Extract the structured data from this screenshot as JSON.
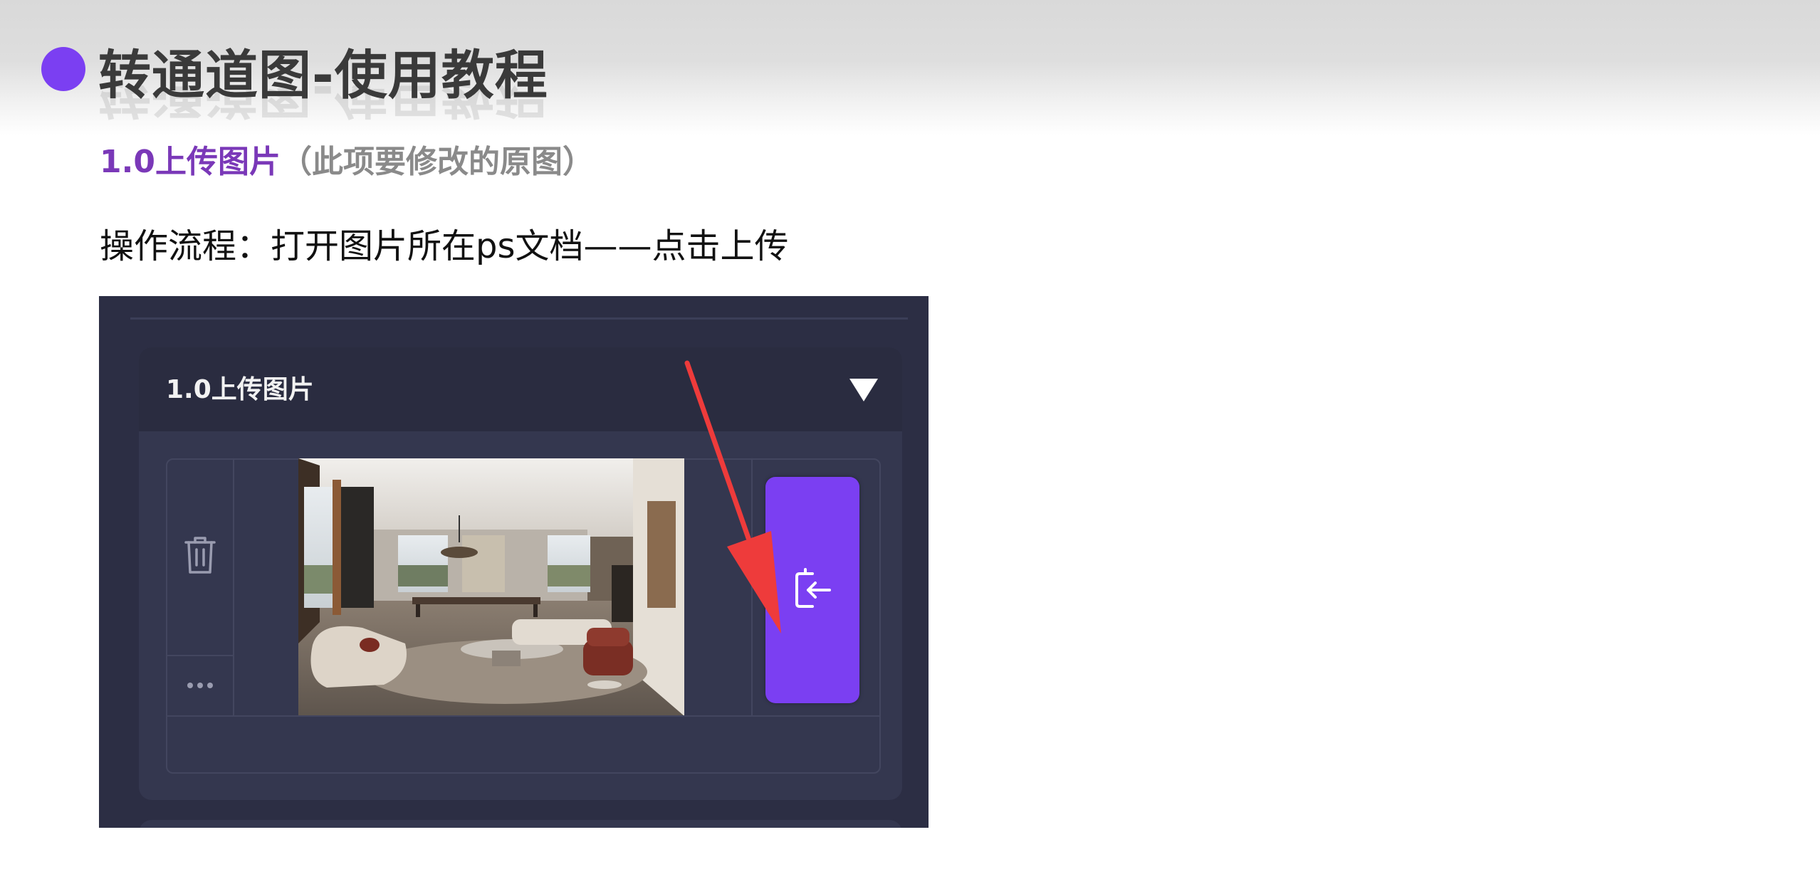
{
  "slide": {
    "title": "转通道图-使用教程",
    "subtitle_main": "1.0上传图片",
    "subtitle_note": "（此项要修改的原图）",
    "step": "操作流程：打开图片所在ps文档——点击上传"
  },
  "app": {
    "section_label": "1.0上传图片",
    "icons": {
      "collapse": "triangle-down-icon",
      "delete": "trash-icon",
      "more": "more-dots-icon",
      "upload": "upload-import-icon",
      "annotation": "red-arrow"
    },
    "colors": {
      "accent": "#7b3ff2",
      "panel_bg": "#2c2e44",
      "card_bg": "#34374f",
      "header_bg": "#2a2c40",
      "title_text": "#7a38b8",
      "arrow": "#ee3b3b"
    }
  }
}
